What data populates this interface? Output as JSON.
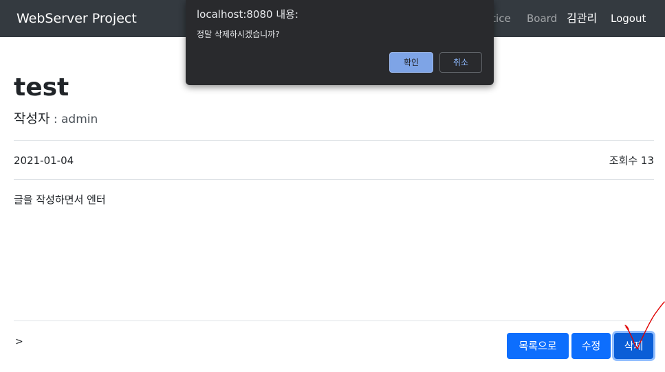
{
  "navbar": {
    "brand": "WebServer Project",
    "items": [
      "otice",
      "Board",
      "김관리",
      "Logout"
    ]
  },
  "post": {
    "title": "test",
    "author_label": "작성자",
    "author_sep": " : ",
    "author": "admin",
    "date": "2021-01-04",
    "views_label": "조회수",
    "views": "13",
    "content": "글을 작성하면서 엔터",
    "extra": ">"
  },
  "buttons": {
    "list": "목록으로",
    "edit": "수정",
    "delete": "삭제"
  },
  "dialog": {
    "title": "localhost:8080 내용:",
    "message": "정말 삭제하시겠습니까?",
    "ok": "확인",
    "cancel": "취소"
  },
  "colors": {
    "navbar_bg": "#343a40",
    "primary": "#0d6efd",
    "dialog_bg": "#292a2d",
    "annotation": "#e00000"
  }
}
